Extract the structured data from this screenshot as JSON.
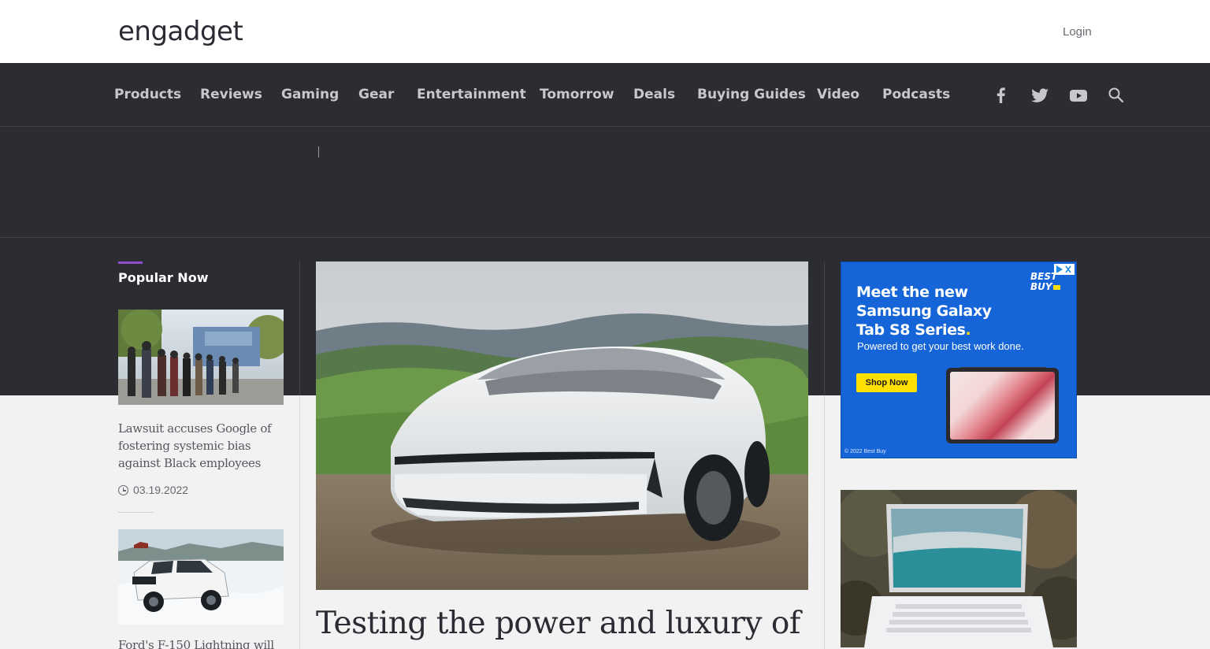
{
  "header": {
    "logo_text": "engadget",
    "login_label": "Login"
  },
  "nav": {
    "items": [
      "Products",
      "Reviews",
      "Gaming",
      "Gear",
      "Entertainment",
      "Tomorrow",
      "Deals",
      "Buying Guides",
      "Video",
      "Podcasts"
    ],
    "icons": [
      "facebook-icon",
      "twitter-icon",
      "youtube-icon",
      "search-icon"
    ]
  },
  "popular": {
    "title": "Popular Now",
    "stories": [
      {
        "title": "Lawsuit accuses Google of fostering systemic bias against Black employees",
        "date": "03.19.2022"
      },
      {
        "title": "Ford's F-150 Lightning will"
      }
    ]
  },
  "hero": {
    "headline": "Testing the power and luxury of"
  },
  "ad": {
    "headline_line1": "Meet the new",
    "headline_line2": "Samsung Galaxy",
    "headline_line3": "Tab S8 Series",
    "headline_dot": ".",
    "subtext": "Powered to get your best work done.",
    "button_label": "Shop Now",
    "brand_line1": "BEST",
    "brand_line2": "BUY",
    "copyright": "© 2022 Best Buy"
  },
  "colors": {
    "nav_background": "#2c2d33",
    "accent_purple": "#8f4ec7",
    "ad_blue": "#1565d8",
    "ad_yellow": "#ffe000"
  }
}
